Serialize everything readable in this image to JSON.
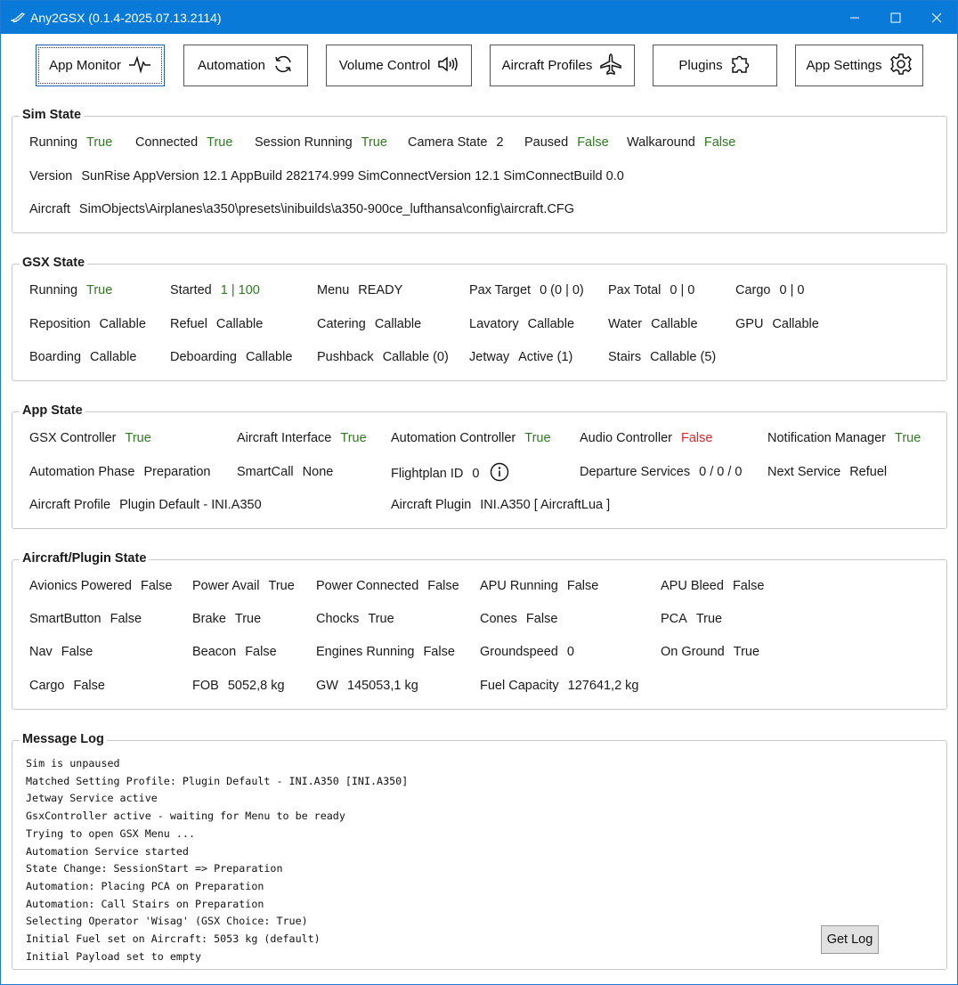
{
  "window": {
    "title": "Any2GSX (0.1.4-2025.07.13.2114)"
  },
  "toolbar": {
    "buttons": [
      {
        "label": "App Monitor"
      },
      {
        "label": "Automation"
      },
      {
        "label": "Volume Control"
      },
      {
        "label": "Aircraft Profiles"
      },
      {
        "label": "Plugins"
      },
      {
        "label": "App Settings"
      }
    ]
  },
  "sim_state": {
    "title": "Sim State",
    "running": {
      "label": "Running",
      "value": "True"
    },
    "connected": {
      "label": "Connected",
      "value": "True"
    },
    "session_running": {
      "label": "Session Running",
      "value": "True"
    },
    "camera_state": {
      "label": "Camera State",
      "value": "2"
    },
    "paused": {
      "label": "Paused",
      "value": "False"
    },
    "walkaround": {
      "label": "Walkaround",
      "value": "False"
    },
    "version": {
      "label": "Version",
      "value": "SunRise AppVersion 12.1 AppBuild 282174.999 SimConnectVersion 12.1 SimConnectBuild 0.0"
    },
    "aircraft": {
      "label": "Aircraft",
      "value": "SimObjects\\Airplanes\\a350\\presets\\inibuilds\\a350-900ce_lufthansa\\config\\aircraft.CFG"
    }
  },
  "gsx_state": {
    "title": "GSX State",
    "running": {
      "label": "Running",
      "value": "True"
    },
    "started": {
      "label": "Started",
      "value": "1 | 100"
    },
    "menu": {
      "label": "Menu",
      "value": "READY"
    },
    "pax_target": {
      "label": "Pax Target",
      "value": "0  (0 | 0)"
    },
    "pax_total": {
      "label": "Pax Total",
      "value": "0 | 0"
    },
    "cargo": {
      "label": "Cargo",
      "value": "0 | 0"
    },
    "reposition": {
      "label": "Reposition",
      "value": "Callable"
    },
    "refuel": {
      "label": "Refuel",
      "value": "Callable"
    },
    "catering": {
      "label": "Catering",
      "value": "Callable"
    },
    "lavatory": {
      "label": "Lavatory",
      "value": "Callable"
    },
    "water": {
      "label": "Water",
      "value": "Callable"
    },
    "gpu": {
      "label": "GPU",
      "value": "Callable"
    },
    "boarding": {
      "label": "Boarding",
      "value": "Callable"
    },
    "deboarding": {
      "label": "Deboarding",
      "value": "Callable"
    },
    "pushback": {
      "label": "Pushback",
      "value": "Callable (0)"
    },
    "jetway": {
      "label": "Jetway",
      "value": "Active (1)"
    },
    "stairs": {
      "label": "Stairs",
      "value": "Callable (5)"
    }
  },
  "app_state": {
    "title": "App State",
    "gsx_controller": {
      "label": "GSX Controller",
      "value": "True"
    },
    "aircraft_interface": {
      "label": "Aircraft Interface",
      "value": "True"
    },
    "automation_controller": {
      "label": "Automation Controller",
      "value": "True"
    },
    "audio_controller": {
      "label": "Audio Controller",
      "value": "False"
    },
    "notification_manager": {
      "label": "Notification Manager",
      "value": "True"
    },
    "automation_phase": {
      "label": "Automation Phase",
      "value": "Preparation"
    },
    "smartcall": {
      "label": "SmartCall",
      "value": "None"
    },
    "flightplan_id": {
      "label": "Flightplan ID",
      "value": "0"
    },
    "departure_services": {
      "label": "Departure Services",
      "value": "0 / 0 / 0"
    },
    "next_service": {
      "label": "Next Service",
      "value": "Refuel"
    },
    "aircraft_profile": {
      "label": "Aircraft Profile",
      "value": "Plugin Default - INI.A350"
    },
    "aircraft_plugin": {
      "label": "Aircraft Plugin",
      "value": "INI.A350 [ AircraftLua ]"
    }
  },
  "plugin_state": {
    "title": "Aircraft/Plugin State",
    "avionics_powered": {
      "label": "Avionics Powered",
      "value": "False"
    },
    "power_avail": {
      "label": "Power Avail",
      "value": "True"
    },
    "power_connected": {
      "label": "Power Connected",
      "value": "False"
    },
    "apu_running": {
      "label": "APU Running",
      "value": "False"
    },
    "apu_bleed": {
      "label": "APU Bleed",
      "value": "False"
    },
    "smartbutton": {
      "label": "SmartButton",
      "value": "False"
    },
    "brake": {
      "label": "Brake",
      "value": "True"
    },
    "chocks": {
      "label": "Chocks",
      "value": "True"
    },
    "cones": {
      "label": "Cones",
      "value": "False"
    },
    "pca": {
      "label": "PCA",
      "value": "True"
    },
    "nav": {
      "label": "Nav",
      "value": "False"
    },
    "beacon": {
      "label": "Beacon",
      "value": "False"
    },
    "engines_running": {
      "label": "Engines Running",
      "value": "False"
    },
    "groundspeed": {
      "label": "Groundspeed",
      "value": "0"
    },
    "on_ground": {
      "label": "On Ground",
      "value": "True"
    },
    "cargo": {
      "label": "Cargo",
      "value": "False"
    },
    "fob": {
      "label": "FOB",
      "value": "5052,8 kg"
    },
    "gw": {
      "label": "GW",
      "value": "145053,1 kg"
    },
    "fuel_capacity": {
      "label": "Fuel Capacity",
      "value": "127641,2 kg"
    }
  },
  "message_log": {
    "title": "Message Log",
    "lines": [
      "Sim is unpaused",
      "Matched Setting Profile: Plugin Default - INI.A350 [INI.A350]",
      "Jetway Service active",
      "GsxController active - waiting for Menu to be ready",
      "Trying to open GSX Menu ...",
      "Automation Service started",
      "State Change: SessionStart => Preparation",
      "Automation: Placing PCA on Preparation",
      "Automation: Call Stairs on Preparation",
      "Selecting Operator 'Wisag' (GSX Choice: True)",
      "Initial Fuel set on Aircraft: 5053 kg (default)",
      "Initial Payload set to empty"
    ],
    "get_log_label": "Get Log"
  },
  "colors": {
    "true_green": "#2d7a1e",
    "false_red": "#e0262a",
    "titlebar": "#0a7ad8"
  }
}
